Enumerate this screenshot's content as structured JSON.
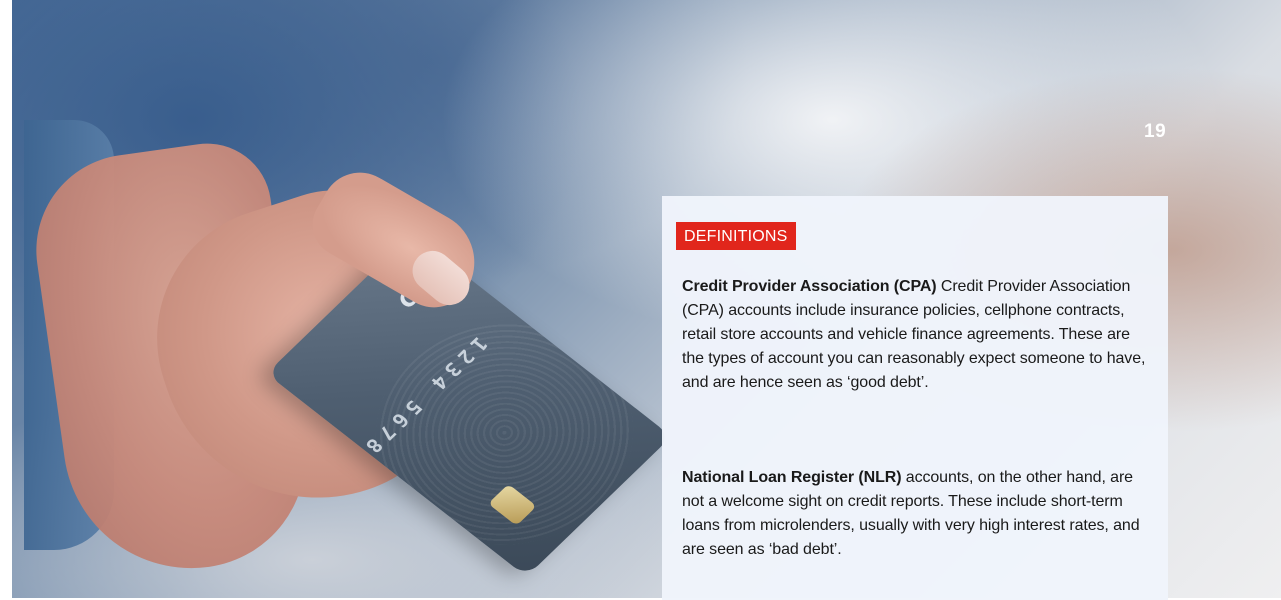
{
  "page": {
    "number": "19"
  },
  "photo": {
    "card_brand_text": "CreditCard",
    "card_number_text": "1234 5678 9101 121"
  },
  "definitions": {
    "label": "DEFINITIONS",
    "items": [
      {
        "term": "Credit Provider Association (CPA)",
        "text": " Credit Provider Association (CPA) accounts include insurance policies, cellphone contracts, retail store accounts and vehicle finance agreements. These are the types of account you can reasonably expect someone to have, and are hence seen as ‘good debt’."
      },
      {
        "term": "National Loan Register (NLR)",
        "text": " accounts, on the other hand, are not a welcome sight on credit reports. These include short-term loans from microlenders, usually with very high interest rates, and are seen as ‘bad debt’."
      }
    ]
  },
  "colors": {
    "label_background": "#e1261c",
    "box_background": "#eff4fb",
    "body_text": "#1a1a1a",
    "page_number": "#ffffff"
  }
}
